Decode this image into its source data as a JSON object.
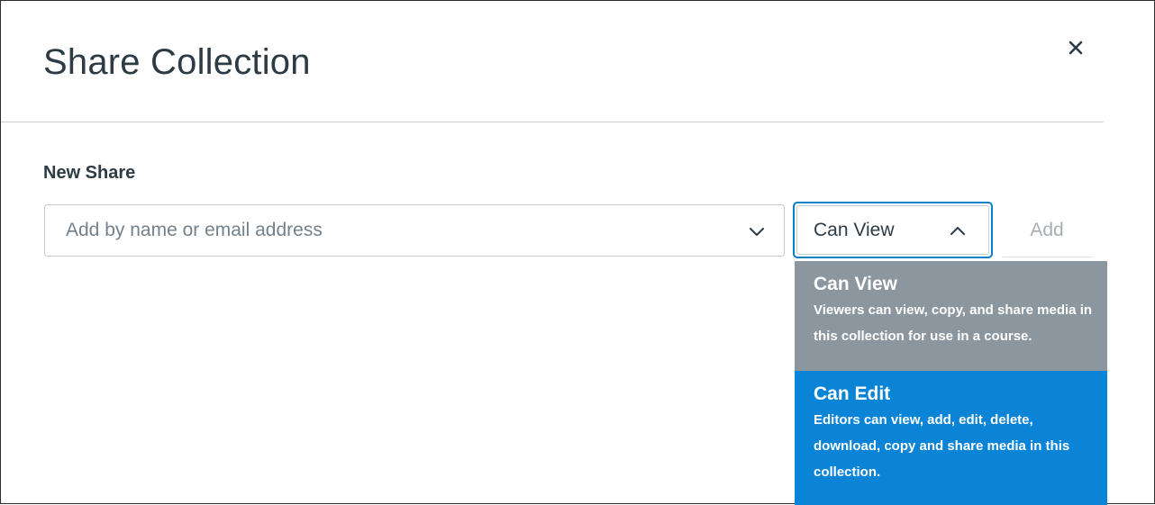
{
  "dialog": {
    "title": "Share Collection",
    "close_label": "×"
  },
  "new_share": {
    "label": "New Share",
    "input": {
      "placeholder": "Add by name or email address",
      "value": ""
    },
    "permission_select": {
      "selected": "Can View",
      "expanded": true
    },
    "add_label": "Add"
  },
  "permission_options": [
    {
      "title": "Can View",
      "description": "Viewers can view, copy, and share media in this collection for use in a course.",
      "state": "selected"
    },
    {
      "title": "Can Edit",
      "description": "Editors can view, add, edit, delete, download, copy and share media in this collection.",
      "state": "highlighted"
    }
  ],
  "colors": {
    "accent": "#0a84d6",
    "selected_option_bg": "#8b969e",
    "title_text": "#2d3b45",
    "placeholder_text": "#73818c",
    "disabled_text": "#a5afb5"
  },
  "icons": {
    "close": "close-icon",
    "input_dropdown": "chevron-down-icon",
    "select_toggle": "chevron-up-icon"
  }
}
